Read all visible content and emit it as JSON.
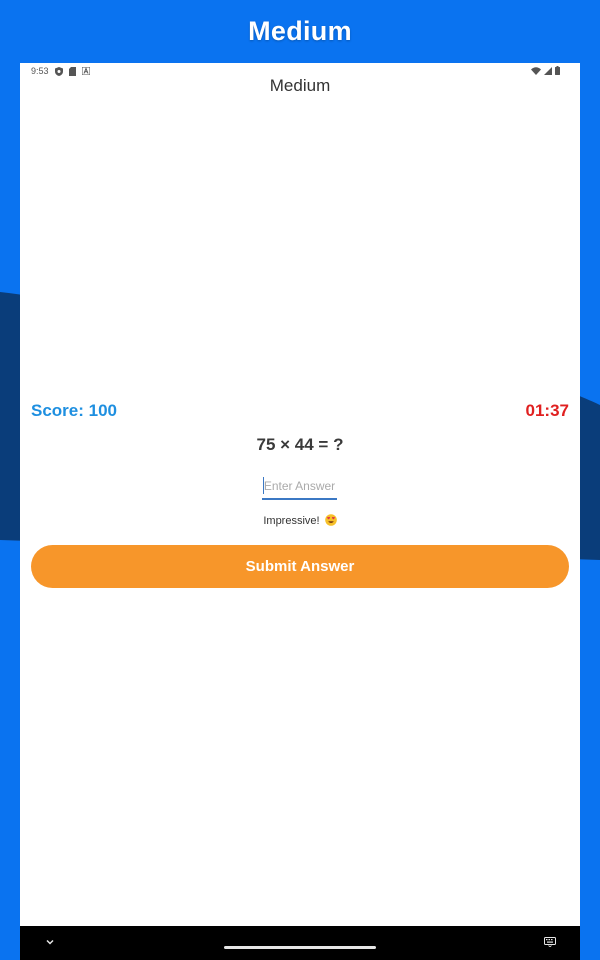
{
  "promo": {
    "title": "Medium"
  },
  "status_bar": {
    "time": "9:53"
  },
  "app": {
    "title": "Medium"
  },
  "game": {
    "score_label": "Score: 100",
    "timer": "01:37",
    "question": "75 × 44 = ?",
    "answer_value": "",
    "answer_placeholder": "Enter Answer",
    "feedback": "Impressive!",
    "feedback_emoji": "heart-eyes-emoji",
    "submit_label": "Submit Answer"
  },
  "colors": {
    "background_blue": "#0a73f0",
    "wave_dark": "#0a3d7a",
    "score_blue": "#1e8fe0",
    "timer_red": "#e02020",
    "button_orange": "#f7962a"
  }
}
